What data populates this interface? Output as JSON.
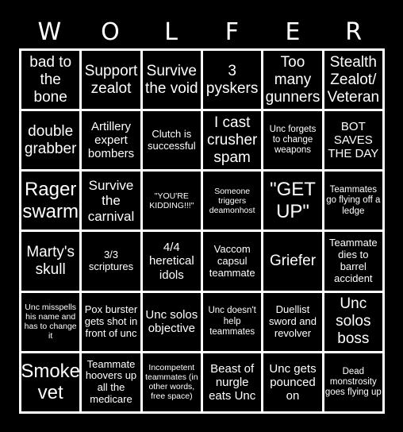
{
  "header": {
    "letters": [
      "W",
      "O",
      "L",
      "F",
      "E",
      "R"
    ]
  },
  "board": {
    "cells": [
      {
        "text": "bad to the bone",
        "size": "s-l"
      },
      {
        "text": "Support zealot",
        "size": "s-l"
      },
      {
        "text": "Survive the void",
        "size": "s-l"
      },
      {
        "text": "3 pyskers",
        "size": "s-l"
      },
      {
        "text": "Too many gunners",
        "size": "s-l"
      },
      {
        "text": "Stealth Zealot/ Veteran",
        "size": "s-l"
      },
      {
        "text": "double grabber",
        "size": "s-l"
      },
      {
        "text": "Artillery expert bombers",
        "size": "s-m"
      },
      {
        "text": "Clutch is successful",
        "size": "s-sm"
      },
      {
        "text": "I cast crusher spam",
        "size": "s-l"
      },
      {
        "text": "Unc forgets to change weapons",
        "size": "s-xs"
      },
      {
        "text": "BOT SAVES THE DAY",
        "size": "s-m"
      },
      {
        "text": "Rager swarm",
        "size": "s-xl"
      },
      {
        "text": "Survive the carnival",
        "size": "s-ml"
      },
      {
        "text": "\"YOU'RE KIDDING!!!\"",
        "size": "s-xxs"
      },
      {
        "text": "Someone triggers deamonhost",
        "size": "s-xxs"
      },
      {
        "text": "\"GET UP\"",
        "size": "s-xl"
      },
      {
        "text": "Teammates go flying off a ledge",
        "size": "s-xs"
      },
      {
        "text": "Marty's skull",
        "size": "s-l"
      },
      {
        "text": "3/3 scriptures",
        "size": "s-sm"
      },
      {
        "text": "4/4 heretical idols",
        "size": "s-m"
      },
      {
        "text": "Vaccom capsul teammate",
        "size": "s-sm"
      },
      {
        "text": "Griefer",
        "size": "s-l"
      },
      {
        "text": "Teammate dies to barrel accident",
        "size": "s-sm"
      },
      {
        "text": "Unc misspells his name and has to change it",
        "size": "s-xxs"
      },
      {
        "text": "Pox burster gets shot in front of unc",
        "size": "s-sm"
      },
      {
        "text": "Unc solos objective",
        "size": "s-m"
      },
      {
        "text": "Unc doesn't help teammates",
        "size": "s-xs"
      },
      {
        "text": "Duellist sword and revolver",
        "size": "s-sm"
      },
      {
        "text": "Unc solos boss",
        "size": "s-l"
      },
      {
        "text": "Smoke vet",
        "size": "s-xl"
      },
      {
        "text": "Teammate hoovers up all the medicare",
        "size": "s-sm"
      },
      {
        "text": "Incompetent teammates (in other words, free space)",
        "size": "s-xxs"
      },
      {
        "text": "Beast of nurgle eats Unc",
        "size": "s-m"
      },
      {
        "text": "Unc gets pounced on",
        "size": "s-m"
      },
      {
        "text": "Dead monstrosity goes flying up",
        "size": "s-xs"
      }
    ]
  },
  "colors": {
    "background": "#000000",
    "grid_lines": "#ffffff",
    "text": "#ffffff"
  }
}
